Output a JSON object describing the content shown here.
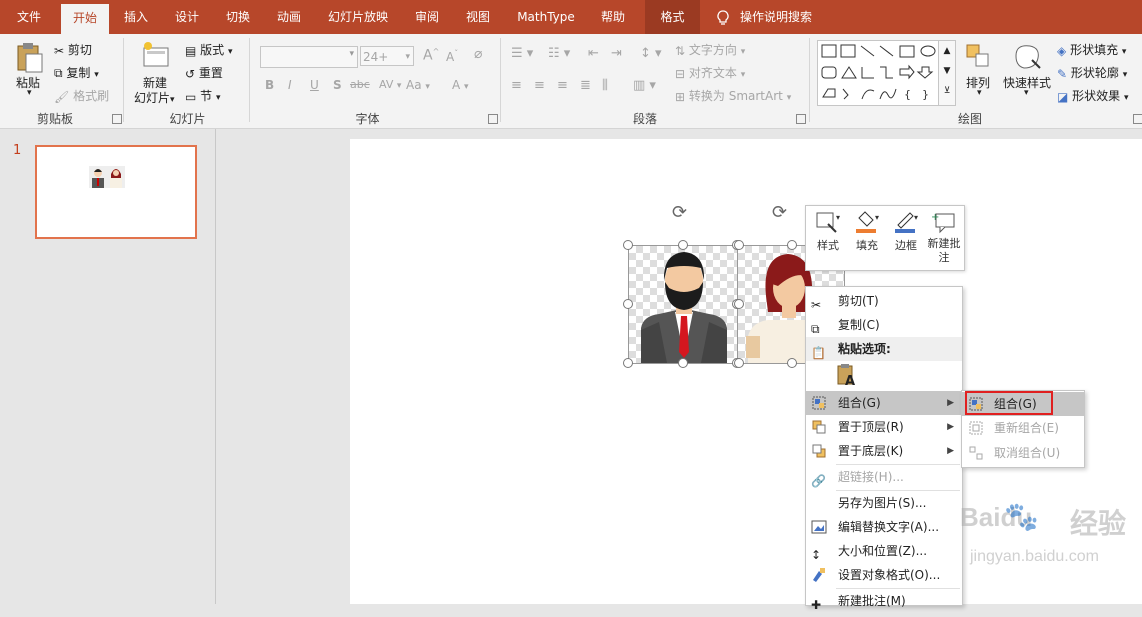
{
  "tabs": [
    "文件",
    "开始",
    "插入",
    "设计",
    "切换",
    "动画",
    "幻灯片放映",
    "审阅",
    "视图",
    "MathType",
    "帮助",
    "格式"
  ],
  "tell_me": "操作说明搜索",
  "clipboard": {
    "paste": "粘贴",
    "cut": "剪切",
    "copy": "复制",
    "format_painter": "格式刷",
    "label": "剪贴板"
  },
  "slides_group": {
    "new_slide_1": "新建",
    "new_slide_2": "幻灯片",
    "layout": "版式",
    "reset": "重置",
    "section": "节",
    "label": "幻灯片"
  },
  "font_group": {
    "font_size": "24+",
    "label": "字体",
    "bold": "B",
    "italic": "I",
    "underline": "U",
    "shadow": "S",
    "strike": "abc",
    "spacing": "AV",
    "case": "Aa",
    "color": "A",
    "grow": "A",
    "shrink": "A"
  },
  "paragraph_group": {
    "text_direction": "文字方向",
    "align_text": "对齐文本",
    "smartart": "转换为 SmartArt",
    "label": "段落"
  },
  "drawing_group": {
    "arrange": "排列",
    "quick_styles": "快速样式",
    "shape_fill": "形状填充",
    "shape_outline": "形状轮廓",
    "shape_effects": "形状效果",
    "label": "绘图"
  },
  "slide_number": "1",
  "mini_toolbar": [
    "样式",
    "填充",
    "边框",
    "新建批注"
  ],
  "context_menu": {
    "cut": "剪切(T)",
    "copy": "复制(C)",
    "paste_options": "粘贴选项:",
    "group": "组合(G)",
    "bring_front": "置于顶层(R)",
    "send_back": "置于底层(K)",
    "hyperlink": "超链接(H)...",
    "save_as_picture": "另存为图片(S)...",
    "edit_alt_text": "编辑替换文字(A)...",
    "size_position": "大小和位置(Z)...",
    "format_object": "设置对象格式(O)...",
    "new_comment": "新建批注(M)"
  },
  "submenu": {
    "group": "组合(G)",
    "regroup": "重新组合(E)",
    "ungroup": "取消组合(U)"
  },
  "watermark": {
    "brand": "Baidu",
    "jingyan": "经验",
    "url": "jingyan.baidu.com"
  },
  "colors": {
    "accent": "#b7472a",
    "highlight_box": "#e02020",
    "thumb_border": "#e2734c"
  }
}
